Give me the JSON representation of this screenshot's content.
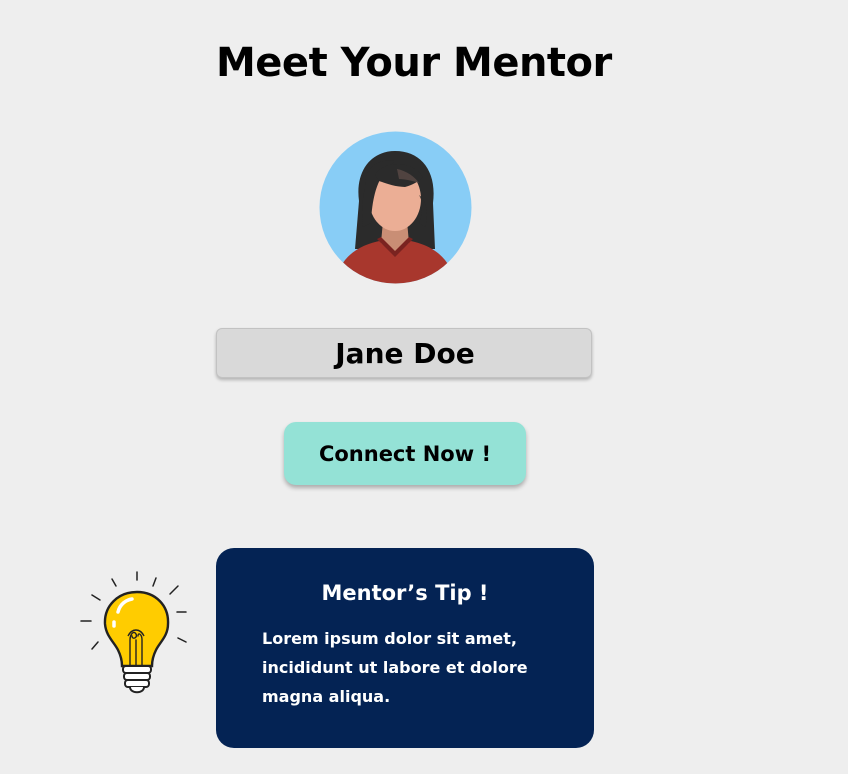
{
  "header": {
    "title": "Meet Your Mentor"
  },
  "mentor": {
    "avatar_icon": "woman-avatar-icon",
    "name": "Jane Doe"
  },
  "actions": {
    "connect_label": "Connect Now !"
  },
  "tip": {
    "icon": "light-bulb-icon",
    "title": "Mentor’s Tip !",
    "body": "Lorem ipsum dolor sit amet, incididunt ut labore et dolore magna aliqua."
  },
  "colors": {
    "background": "#eeeeee",
    "avatar_background": "#88cdf6",
    "name_box": "#d9d9d9",
    "button": "#94e2d6",
    "tip_card": "#042354",
    "bulb": "#ffcc00"
  }
}
